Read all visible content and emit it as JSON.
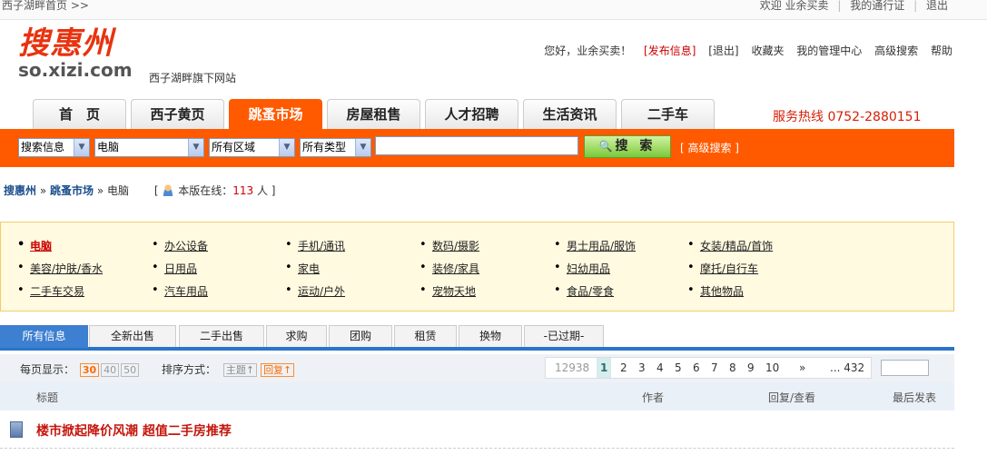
{
  "topbar": {
    "home_link": "西子湖畔首页 >>",
    "user": "欢迎  业余买卖",
    "portal": "我的通行证",
    "logout": "退出"
  },
  "logo": {
    "cn": "搜惠州",
    "en": "so.xizi.com",
    "subsite": "西子湖畔旗下网站"
  },
  "usernav": {
    "greeting": "您好，业余买卖！",
    "publish": "[发布信息]",
    "logout": "[退出]",
    "favorites": "收藏夹",
    "manage": "我的管理中心",
    "advanced": "高级搜索",
    "help": "帮助"
  },
  "tabs": [
    {
      "label": "首　页"
    },
    {
      "label": "西子黄页"
    },
    {
      "label": "跳蚤市场"
    },
    {
      "label": "房屋租售"
    },
    {
      "label": "人才招聘"
    },
    {
      "label": "生活资讯"
    },
    {
      "label": "二手车"
    }
  ],
  "hotline": "服务热线 0752-2880151",
  "search": {
    "type": "搜索信息",
    "category": "电脑",
    "area": "所有区域",
    "kind": "所有类型",
    "keyword": "",
    "button": "搜 索",
    "advanced": "[ 高级搜索 ]"
  },
  "breadcrumb": {
    "root": "搜惠州",
    "market": "跳蚤市场",
    "current": "电脑",
    "online_label": "本版在线：",
    "online_count": "113",
    "online_unit": "人 ]",
    "open": "["
  },
  "categories": [
    {
      "label": "电脑"
    },
    {
      "label": "办公设备"
    },
    {
      "label": "手机/通讯"
    },
    {
      "label": "数码/摄影"
    },
    {
      "label": "男士用品/服饰"
    },
    {
      "label": "女装/精品/首饰"
    },
    {
      "label": "美容/护肤/香水"
    },
    {
      "label": "日用品"
    },
    {
      "label": "家电"
    },
    {
      "label": "装修/家具"
    },
    {
      "label": "妇幼用品"
    },
    {
      "label": "摩托/自行车"
    },
    {
      "label": "二手车交易"
    },
    {
      "label": "汽车用品"
    },
    {
      "label": "运动/户外"
    },
    {
      "label": "宠物天地"
    },
    {
      "label": "食品/零食"
    },
    {
      "label": "其他物品"
    }
  ],
  "subtabs": [
    {
      "label": "所有信息"
    },
    {
      "label": "全新出售"
    },
    {
      "label": "二手出售"
    },
    {
      "label": "求购"
    },
    {
      "label": "团购"
    },
    {
      "label": "租赁"
    },
    {
      "label": "换物"
    },
    {
      "label": "-已过期-"
    }
  ],
  "toolbar": {
    "perpage_label": "每页显示：",
    "perpage": [
      "30",
      "40",
      "50"
    ],
    "sort_label": "排序方式：",
    "sort_subject": "主题↑",
    "sort_reply": "回复↑"
  },
  "pager": {
    "total": "12938",
    "pages": [
      "1",
      "2",
      "3",
      "4",
      "5",
      "6",
      "7",
      "8",
      "9",
      "10"
    ],
    "next": "»",
    "last": "... 432"
  },
  "table": {
    "col_title": "标题",
    "col_author": "作者",
    "col_reply": "回复/查看",
    "col_last": "最后发表"
  },
  "rows": [
    {
      "title": "楼市掀起降价风潮 超值二手房推荐"
    }
  ]
}
